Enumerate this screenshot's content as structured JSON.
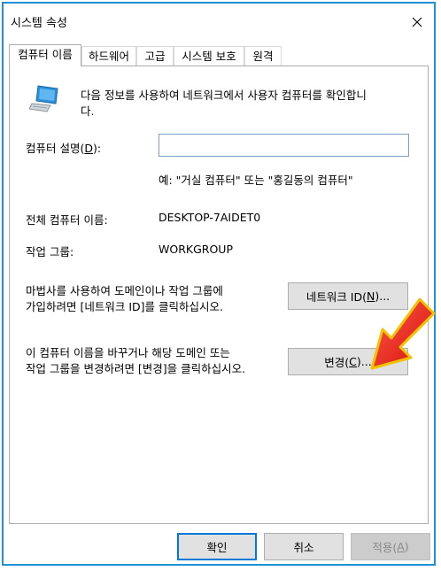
{
  "window": {
    "title": "시스템 속성"
  },
  "tabs": [
    {
      "label": "컴퓨터 이름",
      "active": true
    },
    {
      "label": "하드웨어",
      "active": false
    },
    {
      "label": "고급",
      "active": false
    },
    {
      "label": "시스템 보호",
      "active": false
    },
    {
      "label": "원격",
      "active": false
    }
  ],
  "computer_name_tab": {
    "intro_line1": "다음 정보를 사용하여 네트워크에서 사용자 컴퓨터를 확인합니",
    "intro_line2": "다.",
    "description_label_pre": "컴퓨터 설명(",
    "description_label_key": "D",
    "description_label_post": "):",
    "description_value": "",
    "example_text": "예: \"거실 컴퓨터\" 또는 \"홍길동의 컴퓨터\"",
    "full_name_label": "전체 컴퓨터 이름:",
    "full_name_value": "DESKTOP-7AIDET0",
    "workgroup_label": "작업 그룹:",
    "workgroup_value": "WORKGROUP",
    "network_id_text_line1": "마법사를 사용하여 도메인이나 작업 그룹에",
    "network_id_text_line2": "가입하려면 [네트워크 ID]를 클릭하십시오.",
    "network_id_button_pre": "네트워크 ID(",
    "network_id_button_key": "N",
    "network_id_button_post": ")...",
    "change_text_line1": "이 컴퓨터 이름을 바꾸거나 해당 도메인 또는",
    "change_text_line2": "작업 그룹을 변경하려면 [변경]을 클릭하십시오.",
    "change_button_pre": "변경(",
    "change_button_key": "C",
    "change_button_post": ")..."
  },
  "footer": {
    "ok_label": "확인",
    "cancel_label": "취소",
    "apply_label_pre": "적용(",
    "apply_label_key": "A",
    "apply_label_post": ")"
  },
  "colors": {
    "frame_border": "#1f8fd6",
    "primary_button_border": "#0078d7",
    "annotation_arrow": "#e8231a"
  },
  "icons": [
    "computer-icon",
    "close-icon",
    "red-arrow-annotation"
  ]
}
